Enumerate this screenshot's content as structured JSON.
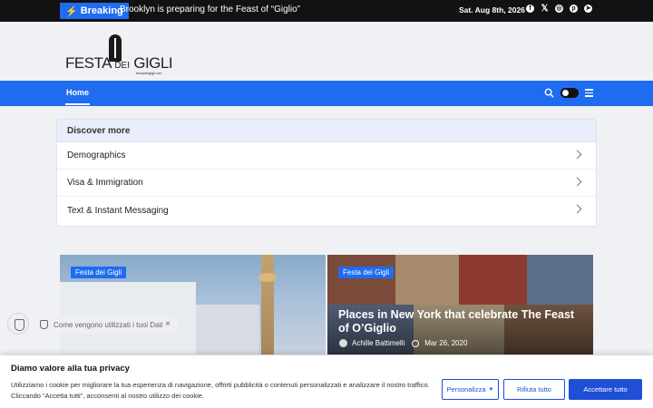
{
  "topbar": {
    "breaking_label": "Breaking",
    "ticker": "Brooklyn is preparing for the Feast of “Giglio”",
    "date": "Sat. Aug 8th, 2026",
    "social_icons": [
      "facebook-icon",
      "x-icon",
      "instagram-icon",
      "pinterest-icon",
      "telegram-icon"
    ]
  },
  "logo": {
    "word_a": "FESTA",
    "word_b": "DEI",
    "word_c": "GIGLI",
    "site": "festadeigigli.net"
  },
  "nav": {
    "home": "Home"
  },
  "discover": {
    "title": "Discover more",
    "items": [
      {
        "label": "Demographics"
      },
      {
        "label": "Visa & Immigration"
      },
      {
        "label": "Text & Instant Messaging"
      }
    ]
  },
  "cards": [
    {
      "badge": "Festa dei Gigli"
    },
    {
      "badge": "Festa dei Gigli",
      "title": "Places in New York that celebrate The Feast of O’Giglio",
      "author": "Achille Battimelli",
      "date": "Mar 26, 2020"
    }
  ],
  "privacy_pill": {
    "text": "Come vengono utilizzati i tuoi Dati"
  },
  "cookie_banner": {
    "title": "Diamo valore alla tua privacy",
    "body": "Utilizziamo i cookie per migliorare la tua esperienza di navigazione, offrirti pubblicità o contenuti personalizzati e analizzare il nostro traffico. Cliccando “Accetta tutti”, acconsenti al nostro utilizzo dei cookie.",
    "customize": "Personalizza",
    "reject": "Rifiuta tutto",
    "accept": "Accettare tutto"
  },
  "colors": {
    "accent": "#1e6cf0",
    "banner_button": "#1e4fd6",
    "topbar": "#121212"
  }
}
